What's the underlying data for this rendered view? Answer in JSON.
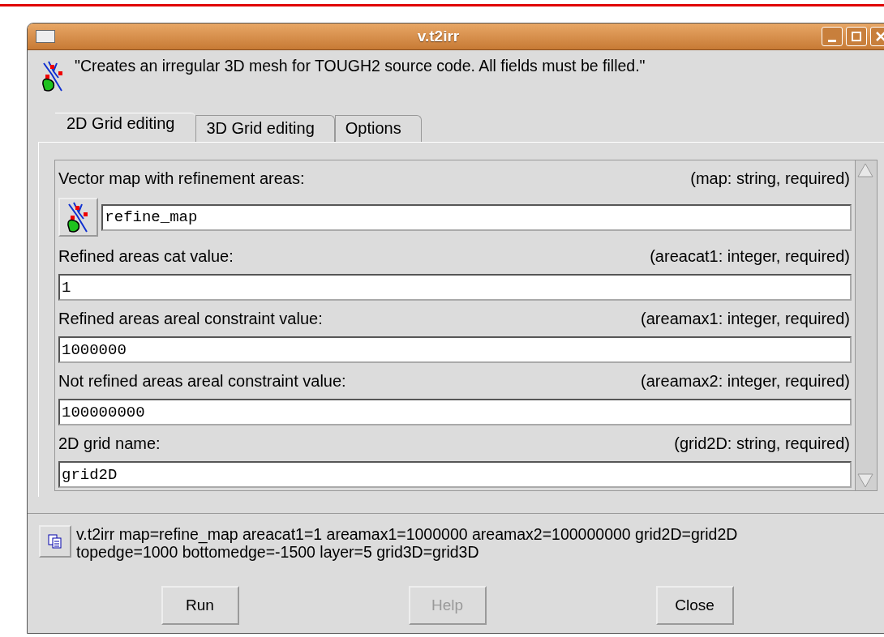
{
  "window": {
    "title": "v.t2irr"
  },
  "description": "\"Creates an irregular 3D mesh for TOUGH2 source code. All fields must be filled.\"",
  "tabs": [
    {
      "label": "2D Grid editing",
      "selected": true
    },
    {
      "label": "3D Grid editing",
      "selected": false
    },
    {
      "label": "Options",
      "selected": false
    }
  ],
  "fields": [
    {
      "kind": "map",
      "label": "Vector map with refinement areas:",
      "spec": "(map:  string, required)",
      "value": "refine_map"
    },
    {
      "kind": "text",
      "label": "Refined areas cat value:",
      "spec": "(areacat1:  integer, required)",
      "value": "1"
    },
    {
      "kind": "text",
      "label": "Refined areas areal constraint value:",
      "spec": "(areamax1:  integer, required)",
      "value": "1000000"
    },
    {
      "kind": "text",
      "label": "Not refined areas areal constraint value:",
      "spec": "(areamax2:  integer, required)",
      "value": "100000000"
    },
    {
      "kind": "text",
      "label": "2D grid name:",
      "spec": "(grid2D:  string, required)",
      "value": "grid2D"
    }
  ],
  "command": [
    "v.t2irr map=refine_map areacat1=1 areamax1=1000000 areamax2=100000000 grid2D=grid2D",
    "topedge=1000 bottomedge=-1500 layer=5 grid3D=grid3D"
  ],
  "buttons": [
    {
      "label": "Run",
      "disabled": false
    },
    {
      "label": "Help",
      "disabled": true
    },
    {
      "label": "Close",
      "disabled": false
    }
  ]
}
